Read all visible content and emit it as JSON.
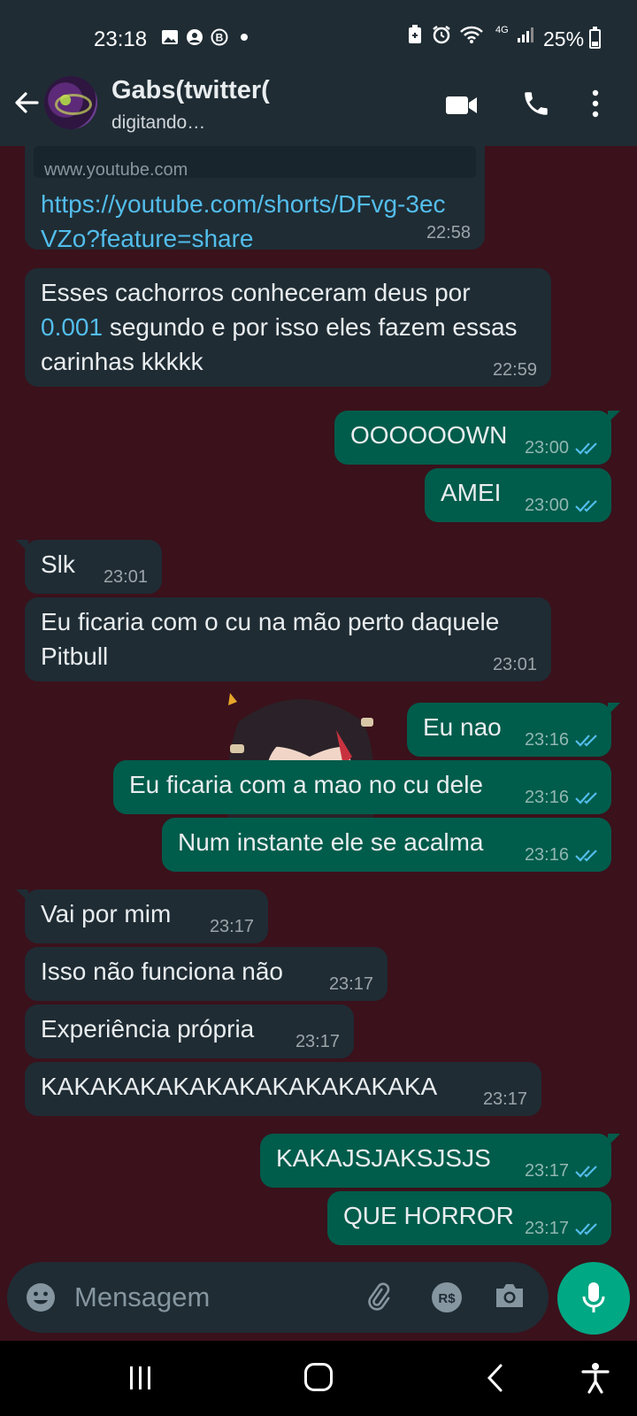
{
  "status_bar": {
    "time": "23:18",
    "network": "4G",
    "battery": "25%",
    "battery_level": 0.25
  },
  "header": {
    "contact_name": "Gabs(twitter(",
    "status": "digitando…"
  },
  "link_preview": {
    "site": "www.youtube.com"
  },
  "messages": [
    {
      "dir": "in",
      "text": "https://youtube.com/shorts/DFvg-3ecVZo?feature=share",
      "time": "22:58"
    },
    {
      "dir": "in",
      "text_before": "Esses cachorros conheceram deus por",
      "number": "0.001",
      "text_after": "segundo e por isso eles fazem essas carinhas kkkkk",
      "time": "22:59"
    },
    {
      "dir": "out",
      "text": "OOOOOOWN",
      "time": "23:00"
    },
    {
      "dir": "out",
      "text": "AMEI",
      "time": "23:00"
    },
    {
      "dir": "in",
      "text": "Slk",
      "time": "23:01"
    },
    {
      "dir": "in",
      "text": "Eu ficaria com o cu na mão perto daquele Pitbull",
      "time": "23:01"
    },
    {
      "dir": "out",
      "text": "Eu nao",
      "time": "23:16"
    },
    {
      "dir": "out",
      "text": "Eu ficaria com a mao no cu dele",
      "time": "23:16"
    },
    {
      "dir": "out",
      "text": "Num instante ele se acalma",
      "time": "23:16"
    },
    {
      "dir": "in",
      "text": "Vai por mim",
      "time": "23:17"
    },
    {
      "dir": "in",
      "text": "Isso não funciona não",
      "time": "23:17"
    },
    {
      "dir": "in",
      "text": "Experiência própria",
      "time": "23:17"
    },
    {
      "dir": "in",
      "text": "KAKAKAKAKAKAKAKAKAKAKAKA",
      "time": "23:17"
    },
    {
      "dir": "out",
      "text": "KAKAJSJAKSJSJS",
      "time": "23:17"
    },
    {
      "dir": "out",
      "text": "QUE HORROR",
      "time": "23:17"
    }
  ],
  "input": {
    "placeholder": "Mensagem"
  },
  "icons": {
    "back": "arrow-left-icon",
    "video": "video-call-icon",
    "call": "phone-icon",
    "more": "more-vertical-icon",
    "emoji": "emoji-icon",
    "attach": "paperclip-icon",
    "payment": "payment-icon",
    "camera": "camera-icon",
    "mic": "microphone-icon"
  },
  "colors": {
    "chat_background": "#3b111b",
    "incoming_bubble": "#1f2c34",
    "outgoing_bubble": "#005c4b",
    "link": "#53bdeb",
    "read_ticks": "#53bdeb",
    "accent": "#00a884"
  }
}
